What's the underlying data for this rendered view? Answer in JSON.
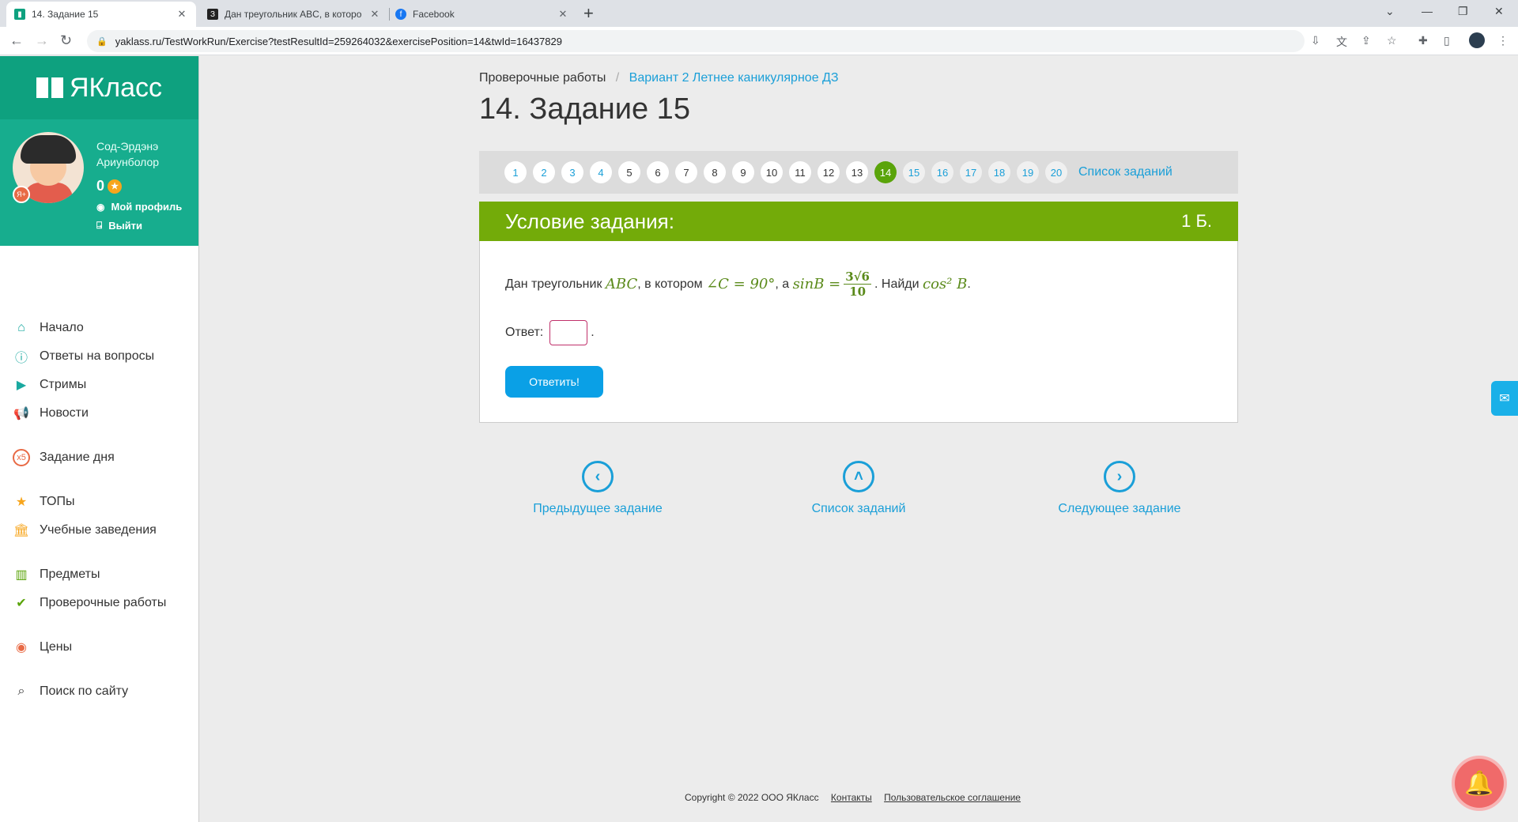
{
  "browser": {
    "tabs": [
      {
        "title": "14. Задание 15",
        "favicon": "yaklass-icon",
        "active": true
      },
      {
        "title": "Дан треугольник ABC, в которо",
        "favicon": "znanija-icon",
        "active": false
      },
      {
        "title": "Facebook",
        "favicon": "facebook-icon",
        "active": false
      }
    ],
    "url": "yaklass.ru/TestWorkRun/Exercise?testResultId=259264032&exercisePosition=14&twId=16437829"
  },
  "sidebar": {
    "logo": "ЯКласс",
    "user": {
      "name_line1": "Сод-Эрдэнэ",
      "name_line2": "Ариунболор",
      "points": "0"
    },
    "profile_link": "Мой профиль",
    "logout_link": "Выйти",
    "menu": [
      {
        "label": "Начало",
        "icon": "home-icon"
      },
      {
        "label": "Ответы на вопросы",
        "icon": "question-icon"
      },
      {
        "label": "Стримы",
        "icon": "play-icon"
      },
      {
        "label": "Новости",
        "icon": "megaphone-icon"
      },
      {
        "label": "Задание дня",
        "icon": "x5-icon"
      },
      {
        "label": "ТОПы",
        "icon": "star-icon"
      },
      {
        "label": "Учебные заведения",
        "icon": "school-icon"
      },
      {
        "label": "Предметы",
        "icon": "books-icon"
      },
      {
        "label": "Проверочные работы",
        "icon": "check-icon"
      },
      {
        "label": "Цены",
        "icon": "price-icon"
      },
      {
        "label": "Поиск по сайту",
        "icon": "search-icon"
      }
    ]
  },
  "main": {
    "breadcrumb": {
      "root": "Проверочные работы",
      "current": "Вариант 2 Летнее каникулярное ДЗ"
    },
    "title": "14. Задание 15",
    "pager": {
      "pages": [
        "1",
        "2",
        "3",
        "4",
        "5",
        "6",
        "7",
        "8",
        "9",
        "10",
        "11",
        "12",
        "13",
        "14",
        "15",
        "16",
        "17",
        "18",
        "19",
        "20"
      ],
      "current": "14",
      "list_link": "Список заданий"
    },
    "task": {
      "header": "Условие задания:",
      "points": "1 Б.",
      "q_intro": "Дан треугольник",
      "q_abc": "ABC",
      "q_mid1": ", в котором",
      "q_angle": "∠C = 90°",
      "q_mid2": ", а",
      "q_sin": "sinB =",
      "q_frac_num": "3√6",
      "q_frac_den": "10",
      "q_mid3": ". Найди",
      "q_cos": "cos² B",
      "q_end": ".",
      "answer_label": "Ответ:",
      "answer_value": "",
      "submit_label": "Ответить!"
    },
    "bottom_nav": {
      "prev": "Предыдущее задание",
      "list": "Список заданий",
      "next": "Следующее задание"
    }
  },
  "footer": {
    "copyright": "Copyright © 2022 ООО ЯКласс",
    "contacts": "Контакты",
    "agreement": "Пользовательское соглашение"
  }
}
